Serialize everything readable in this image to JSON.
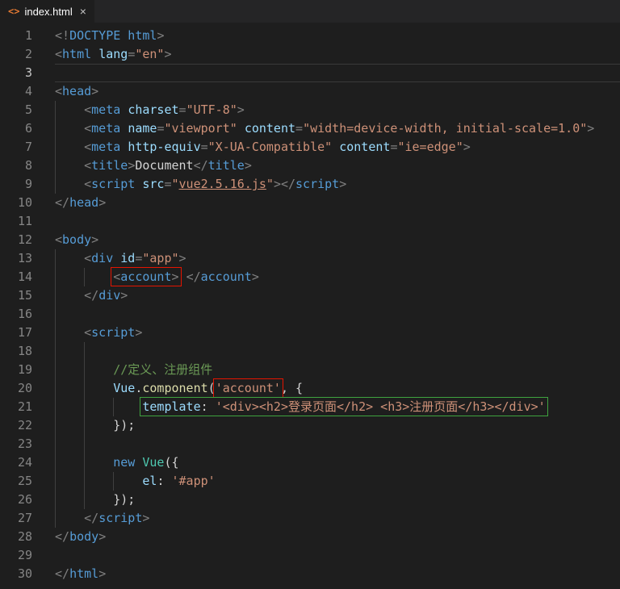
{
  "tab": {
    "icon": "<>",
    "title": "index.html",
    "close": "×"
  },
  "editor": {
    "lines": [
      {
        "num": 1,
        "tokens": [
          {
            "t": "<!",
            "c": "p"
          },
          {
            "t": "DOCTYPE html",
            "c": "tag"
          },
          {
            "t": ">",
            "c": "p"
          }
        ]
      },
      {
        "num": 2,
        "tokens": [
          {
            "t": "<",
            "c": "p"
          },
          {
            "t": "html",
            "c": "tag"
          },
          {
            "t": " ",
            "c": "w"
          },
          {
            "t": "lang",
            "c": "attr"
          },
          {
            "t": "=",
            "c": "p"
          },
          {
            "t": "\"en\"",
            "c": "str"
          },
          {
            "t": ">",
            "c": "p"
          }
        ]
      },
      {
        "num": 3,
        "current": true,
        "tokens": []
      },
      {
        "num": 4,
        "tokens": [
          {
            "t": "<",
            "c": "p"
          },
          {
            "t": "head",
            "c": "tag"
          },
          {
            "t": ">",
            "c": "p"
          }
        ]
      },
      {
        "num": 5,
        "guides": [
          0
        ],
        "tokens": [
          {
            "t": "    ",
            "c": "w"
          },
          {
            "t": "<",
            "c": "p"
          },
          {
            "t": "meta",
            "c": "tag"
          },
          {
            "t": " ",
            "c": "w"
          },
          {
            "t": "charset",
            "c": "attr"
          },
          {
            "t": "=",
            "c": "p"
          },
          {
            "t": "\"UTF-8\"",
            "c": "str"
          },
          {
            "t": ">",
            "c": "p"
          }
        ]
      },
      {
        "num": 6,
        "guides": [
          0
        ],
        "tokens": [
          {
            "t": "    ",
            "c": "w"
          },
          {
            "t": "<",
            "c": "p"
          },
          {
            "t": "meta",
            "c": "tag"
          },
          {
            "t": " ",
            "c": "w"
          },
          {
            "t": "name",
            "c": "attr"
          },
          {
            "t": "=",
            "c": "p"
          },
          {
            "t": "\"viewport\"",
            "c": "str"
          },
          {
            "t": " ",
            "c": "w"
          },
          {
            "t": "content",
            "c": "attr"
          },
          {
            "t": "=",
            "c": "p"
          },
          {
            "t": "\"width=device-width, initial-scale=1.0\"",
            "c": "str"
          },
          {
            "t": ">",
            "c": "p"
          }
        ]
      },
      {
        "num": 7,
        "guides": [
          0
        ],
        "tokens": [
          {
            "t": "    ",
            "c": "w"
          },
          {
            "t": "<",
            "c": "p"
          },
          {
            "t": "meta",
            "c": "tag"
          },
          {
            "t": " ",
            "c": "w"
          },
          {
            "t": "http-equiv",
            "c": "attr"
          },
          {
            "t": "=",
            "c": "p"
          },
          {
            "t": "\"X-UA-Compatible\"",
            "c": "str"
          },
          {
            "t": " ",
            "c": "w"
          },
          {
            "t": "content",
            "c": "attr"
          },
          {
            "t": "=",
            "c": "p"
          },
          {
            "t": "\"ie=edge\"",
            "c": "str"
          },
          {
            "t": ">",
            "c": "p"
          }
        ]
      },
      {
        "num": 8,
        "guides": [
          0
        ],
        "tokens": [
          {
            "t": "    ",
            "c": "w"
          },
          {
            "t": "<",
            "c": "p"
          },
          {
            "t": "title",
            "c": "tag"
          },
          {
            "t": ">",
            "c": "p"
          },
          {
            "t": "Document",
            "c": "txt"
          },
          {
            "t": "</",
            "c": "p"
          },
          {
            "t": "title",
            "c": "tag"
          },
          {
            "t": ">",
            "c": "p"
          }
        ]
      },
      {
        "num": 9,
        "guides": [
          0
        ],
        "tokens": [
          {
            "t": "    ",
            "c": "w"
          },
          {
            "t": "<",
            "c": "p"
          },
          {
            "t": "script",
            "c": "tag"
          },
          {
            "t": " ",
            "c": "w"
          },
          {
            "t": "src",
            "c": "attr"
          },
          {
            "t": "=",
            "c": "p"
          },
          {
            "t": "\"",
            "c": "str"
          },
          {
            "t": "vue2.5.16.js",
            "c": "link"
          },
          {
            "t": "\"",
            "c": "str"
          },
          {
            "t": ">",
            "c": "p"
          },
          {
            "t": "</",
            "c": "p"
          },
          {
            "t": "script",
            "c": "tag"
          },
          {
            "t": ">",
            "c": "p"
          }
        ]
      },
      {
        "num": 10,
        "tokens": [
          {
            "t": "</",
            "c": "p"
          },
          {
            "t": "head",
            "c": "tag"
          },
          {
            "t": ">",
            "c": "p"
          }
        ]
      },
      {
        "num": 11,
        "tokens": []
      },
      {
        "num": 12,
        "tokens": [
          {
            "t": "<",
            "c": "p"
          },
          {
            "t": "body",
            "c": "tag"
          },
          {
            "t": ">",
            "c": "p"
          }
        ]
      },
      {
        "num": 13,
        "guides": [
          0
        ],
        "tokens": [
          {
            "t": "    ",
            "c": "w"
          },
          {
            "t": "<",
            "c": "p"
          },
          {
            "t": "div",
            "c": "tag"
          },
          {
            "t": " ",
            "c": "w"
          },
          {
            "t": "id",
            "c": "attr"
          },
          {
            "t": "=",
            "c": "p"
          },
          {
            "t": "\"app\"",
            "c": "str"
          },
          {
            "t": ">",
            "c": "p"
          }
        ]
      },
      {
        "num": 14,
        "guides": [
          0,
          4
        ],
        "tokens": [
          {
            "t": "        ",
            "c": "w"
          },
          {
            "box": "red",
            "tokens": [
              {
                "t": "<",
                "c": "p"
              },
              {
                "t": "account",
                "c": "tag"
              },
              {
                "t": ">",
                "c": "p"
              }
            ]
          },
          {
            "t": " ",
            "c": "w"
          },
          {
            "t": "</",
            "c": "p"
          },
          {
            "t": "account",
            "c": "tag"
          },
          {
            "t": ">",
            "c": "p"
          }
        ]
      },
      {
        "num": 15,
        "guides": [
          0
        ],
        "tokens": [
          {
            "t": "    ",
            "c": "w"
          },
          {
            "t": "</",
            "c": "p"
          },
          {
            "t": "div",
            "c": "tag"
          },
          {
            "t": ">",
            "c": "p"
          }
        ]
      },
      {
        "num": 16,
        "guides": [
          0
        ],
        "tokens": []
      },
      {
        "num": 17,
        "guides": [
          0
        ],
        "tokens": [
          {
            "t": "    ",
            "c": "w"
          },
          {
            "t": "<",
            "c": "p"
          },
          {
            "t": "script",
            "c": "tag"
          },
          {
            "t": ">",
            "c": "p"
          }
        ]
      },
      {
        "num": 18,
        "guides": [
          0,
          4
        ],
        "tokens": []
      },
      {
        "num": 19,
        "guides": [
          0,
          4
        ],
        "tokens": [
          {
            "t": "        ",
            "c": "w"
          },
          {
            "t": "//定义、注册组件",
            "c": "cmt"
          }
        ]
      },
      {
        "num": 20,
        "guides": [
          0,
          4
        ],
        "tokens": [
          {
            "t": "        ",
            "c": "w"
          },
          {
            "t": "Vue",
            "c": "var"
          },
          {
            "t": ".",
            "c": "txt"
          },
          {
            "t": "component",
            "c": "fn"
          },
          {
            "t": "(",
            "c": "txt"
          },
          {
            "box": "red",
            "tokens": [
              {
                "t": "'account'",
                "c": "str"
              }
            ]
          },
          {
            "t": ", {",
            "c": "txt"
          }
        ]
      },
      {
        "num": 21,
        "guides": [
          0,
          4,
          8
        ],
        "tokens": [
          {
            "t": "            ",
            "c": "w"
          },
          {
            "box": "green",
            "tokens": [
              {
                "t": "template",
                "c": "attr"
              },
              {
                "t": ": ",
                "c": "txt"
              },
              {
                "t": "'<div><h2>登录页面</h2> <h3>注册页面</h3></div>'",
                "c": "str"
              }
            ]
          }
        ]
      },
      {
        "num": 22,
        "guides": [
          0,
          4
        ],
        "tokens": [
          {
            "t": "        ",
            "c": "w"
          },
          {
            "t": "});",
            "c": "txt"
          }
        ]
      },
      {
        "num": 23,
        "guides": [
          0,
          4
        ],
        "tokens": []
      },
      {
        "num": 24,
        "guides": [
          0,
          4
        ],
        "tokens": [
          {
            "t": "        ",
            "c": "w"
          },
          {
            "t": "new",
            "c": "kw"
          },
          {
            "t": " ",
            "c": "w"
          },
          {
            "t": "Vue",
            "c": "cls"
          },
          {
            "t": "({",
            "c": "txt"
          }
        ]
      },
      {
        "num": 25,
        "guides": [
          0,
          4,
          8
        ],
        "tokens": [
          {
            "t": "            ",
            "c": "w"
          },
          {
            "t": "el",
            "c": "attr"
          },
          {
            "t": ": ",
            "c": "txt"
          },
          {
            "t": "'#app'",
            "c": "str"
          }
        ]
      },
      {
        "num": 26,
        "guides": [
          0,
          4
        ],
        "tokens": [
          {
            "t": "        ",
            "c": "w"
          },
          {
            "t": "});",
            "c": "txt"
          }
        ]
      },
      {
        "num": 27,
        "guides": [
          0
        ],
        "tokens": [
          {
            "t": "    ",
            "c": "w"
          },
          {
            "t": "</",
            "c": "p"
          },
          {
            "t": "script",
            "c": "tag"
          },
          {
            "t": ">",
            "c": "p"
          }
        ]
      },
      {
        "num": 28,
        "tokens": [
          {
            "t": "</",
            "c": "p"
          },
          {
            "t": "body",
            "c": "tag"
          },
          {
            "t": ">",
            "c": "p"
          }
        ]
      },
      {
        "num": 29,
        "tokens": []
      },
      {
        "num": 30,
        "tokens": [
          {
            "t": "</",
            "c": "p"
          },
          {
            "t": "html",
            "c": "tag"
          },
          {
            "t": ">",
            "c": "p"
          }
        ]
      }
    ]
  }
}
